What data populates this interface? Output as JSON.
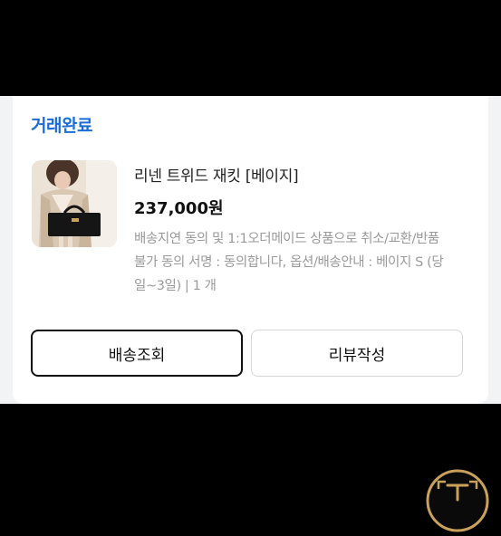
{
  "order": {
    "status": "거래완료",
    "product_title": "리넨 트위드 재킷 [베이지]",
    "price": "237,000원",
    "description": "배송지연 동의 및 1:1오더메이드 상품으로 취소/교환/반품불가 동의 서명 : 동의합니다, 옵션/배송안내 : 베이지 S (당일~3일) | 1 개"
  },
  "buttons": {
    "track_delivery": "배송조회",
    "write_review": "리뷰작성"
  },
  "icons": {
    "corner_badge": "t-logo-icon"
  },
  "colors": {
    "status": "#1a6dd8",
    "badge_gold": "#c8a15a"
  }
}
